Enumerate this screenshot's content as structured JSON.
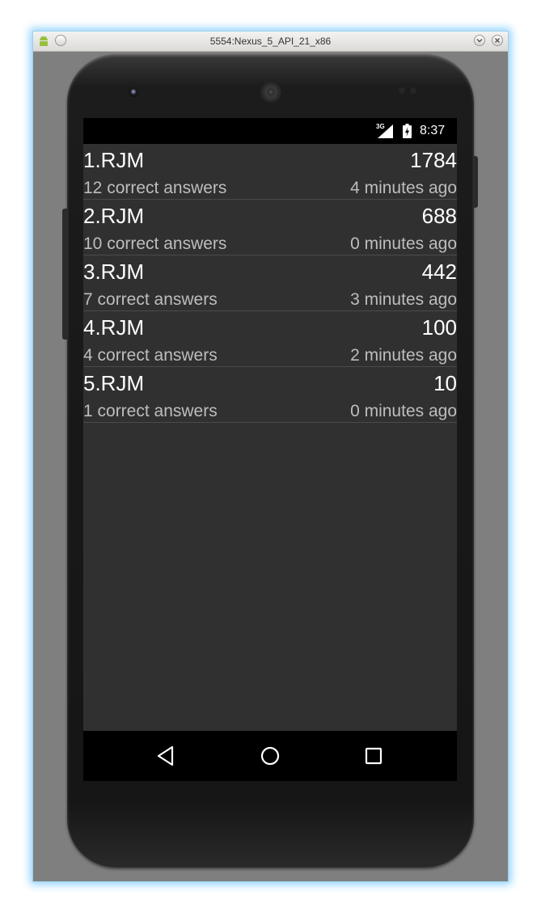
{
  "window": {
    "title": "5554:Nexus_5_API_21_x86"
  },
  "statusbar": {
    "network": "3G",
    "time": "8:37"
  },
  "scores": [
    {
      "title": "1.RJM",
      "score": "1784",
      "answers": "12 correct answers",
      "time": "4 minutes ago"
    },
    {
      "title": "2.RJM",
      "score": "688",
      "answers": "10 correct answers",
      "time": "0 minutes ago"
    },
    {
      "title": "3.RJM",
      "score": "442",
      "answers": "7 correct answers",
      "time": "3 minutes ago"
    },
    {
      "title": "4.RJM",
      "score": "100",
      "answers": "4 correct answers",
      "time": "2 minutes ago"
    },
    {
      "title": "5.RJM",
      "score": "10",
      "answers": "1 correct answers",
      "time": "0 minutes ago"
    }
  ],
  "navbar": {
    "back_icon": "back-triangle-icon",
    "home_icon": "home-circle-icon",
    "recents_icon": "recents-square-icon"
  },
  "colors": {
    "screen_bg": "#303030",
    "primary_text": "#ffffff",
    "secondary_text": "#bdbdbd"
  }
}
